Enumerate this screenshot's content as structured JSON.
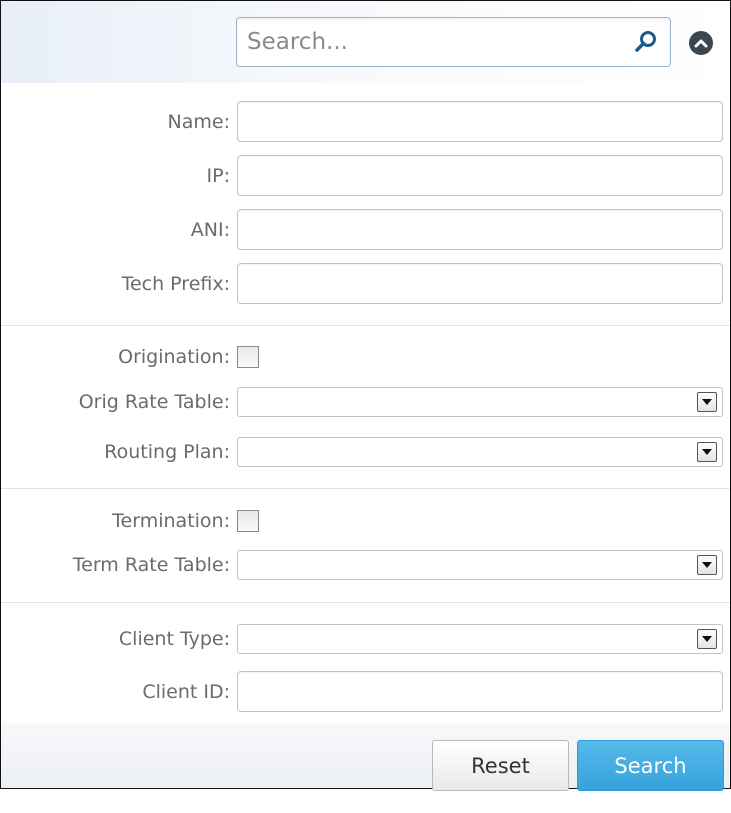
{
  "search": {
    "placeholder": "Search...",
    "value": ""
  },
  "filters": {
    "name": {
      "label": "Name:",
      "value": ""
    },
    "ip": {
      "label": "IP:",
      "value": ""
    },
    "ani": {
      "label": "ANI:",
      "value": ""
    },
    "tech_prefix": {
      "label": "Tech Prefix:",
      "value": ""
    },
    "origination": {
      "label": "Origination:",
      "checked": false
    },
    "orig_rate_table": {
      "label": "Orig Rate Table:",
      "value": ""
    },
    "routing_plan": {
      "label": "Routing Plan:",
      "value": ""
    },
    "termination": {
      "label": "Termination:",
      "checked": false
    },
    "term_rate_table": {
      "label": "Term Rate Table:",
      "value": ""
    },
    "client_type": {
      "label": "Client Type:",
      "value": ""
    },
    "client_id": {
      "label": "Client ID:",
      "value": ""
    }
  },
  "buttons": {
    "reset": "Reset",
    "search": "Search"
  },
  "icons": {
    "search": "magnifier-icon",
    "collapse": "chevron-up-icon",
    "dropdown": "dropdown-arrow-icon"
  },
  "colors": {
    "accent": "#35a3dd",
    "label": "#6b6b6b",
    "border": "#c3c3c3"
  }
}
